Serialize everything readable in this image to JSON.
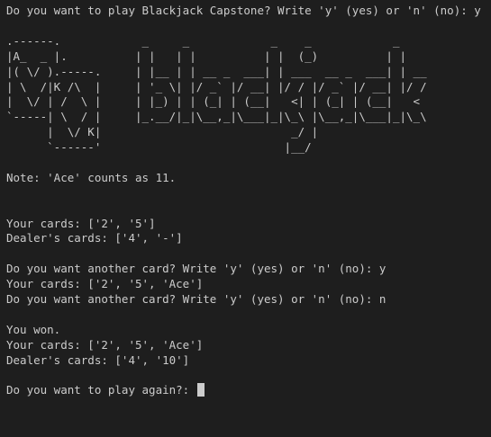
{
  "terminal": {
    "colors": {
      "background": "#1e1e1e",
      "text": "#cccccc"
    },
    "lines": [
      "Do you want to play Blackjack Capstone? Write 'y' (yes) or 'n' (no): y",
      "",
      "__ASCII_ART__",
      "Note: 'Ace' counts as 11.",
      "",
      "",
      "Your cards: ['2', '5']",
      "Dealer's cards: ['4', '-']",
      "",
      "Do you want another card? Write 'y' (yes) or 'n' (no): y",
      "Your cards: ['2', '5', 'Ace']",
      "Do you want another card? Write 'y' (yes) or 'n' (no): n",
      "",
      "You won.",
      "Your cards: ['2', '5', 'Ace']",
      "Dealer's cards: ['4', '10']",
      "",
      "Do you want to play again?: "
    ],
    "ascii_art": ".------.            _     _            _    _            _\n|A_  _ |.          | |   | |          | |  (_)          | |\n|( \\/ ).-----.     | |__ | | __ _  ___| | ___  __ _  ___| | __\n| \\  /|K /\\  |     | '_ \\| |/ _` |/ __| |/ / |/ _` |/ __| |/ /\n|  \\/ | /  \\ |     | |_) | | (_| | (__|   <| | (_| | (__|   <\n`-----| \\  / |     |_.__/|_|\\__,_|\\___|_|\\_\\ |\\__,_|\\___|_|\\_\\\n      |  \\/ K|                            _/ |\n      `------'                           |__/"
  }
}
